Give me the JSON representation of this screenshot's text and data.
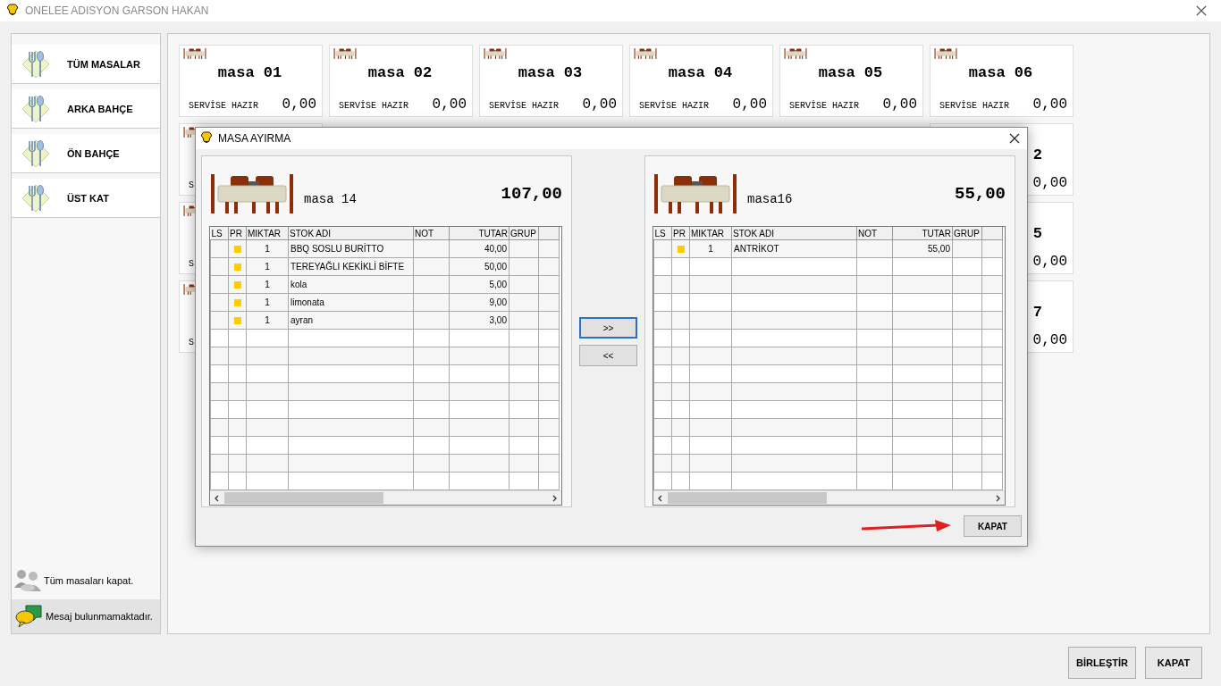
{
  "window": {
    "title": "ONELEE ADISYON GARSON HAKAN"
  },
  "sidebar": {
    "items": [
      {
        "label": "TÜM MASALAR"
      },
      {
        "label": "ARKA BAHÇE"
      },
      {
        "label": "ÖN BAHÇE"
      },
      {
        "label": "ÜST KAT"
      }
    ],
    "footer": [
      {
        "kind": "action",
        "label": "Tüm masaları kapat."
      },
      {
        "kind": "message",
        "label": "Mesaj bulunmamaktadır."
      }
    ]
  },
  "tables": [
    {
      "name": "masa 01",
      "status": "SERVİSE HAZIR",
      "amount": "0,00"
    },
    {
      "name": "masa 02",
      "status": "SERVİSE HAZIR",
      "amount": "0,00"
    },
    {
      "name": "masa 03",
      "status": "SERVİSE HAZIR",
      "amount": "0,00"
    },
    {
      "name": "masa 04",
      "status": "SERVİSE HAZIR",
      "amount": "0,00"
    },
    {
      "name": "masa 05",
      "status": "SERVİSE HAZIR",
      "amount": "0,00"
    },
    {
      "name": "masa 06",
      "status": "SERVİSE HAZIR",
      "amount": "0,00"
    }
  ],
  "covered_tables": [
    {
      "left_status": "S",
      "right_name": "2",
      "right_amount": "0,00"
    },
    {
      "left_status": "S",
      "right_name": "5",
      "right_amount": "0,00"
    },
    {
      "left_status": "S",
      "right_name": "7",
      "right_amount": "0,00"
    }
  ],
  "buttons": [
    "BİRLEŞTİR",
    "KAPAT"
  ],
  "dialog": {
    "title": "MASA AYIRMA",
    "panels": [
      {
        "table_name": "masa 14",
        "total": "107,00",
        "columns": [
          "LS",
          "PR",
          "MIKTAR",
          "STOK ADI",
          "NOT",
          "TUTAR",
          "GRUP"
        ],
        "rows": [
          {
            "printed": true,
            "quantity": "1",
            "item": "BBQ SOSLU BURİTTO",
            "amount": "40,00"
          },
          {
            "printed": true,
            "quantity": "1",
            "item": "TEREYAĞLI KEKİKLİ BİFTE",
            "amount": "50,00"
          },
          {
            "printed": true,
            "quantity": "1",
            "item": "kola",
            "amount": "5,00"
          },
          {
            "printed": true,
            "quantity": "1",
            "item": "limonata",
            "amount": "9,00"
          },
          {
            "printed": true,
            "quantity": "1",
            "item": "ayran",
            "amount": "3,00"
          }
        ]
      },
      {
        "table_name": "masa16",
        "total": "55,00",
        "columns": [
          "LS",
          "PR",
          "MIKTAR",
          "STOK ADI",
          "NOT",
          "TUTAR",
          "GRUP"
        ],
        "rows": [
          {
            "printed": true,
            "quantity": "1",
            "item": "ANTRİKOT",
            "amount": "55,00"
          }
        ]
      }
    ],
    "move_buttons": [
      {
        "label": ">>",
        "focused": true
      },
      {
        "label": "<<",
        "focused": false
      }
    ],
    "close_button": "KAPAT"
  }
}
